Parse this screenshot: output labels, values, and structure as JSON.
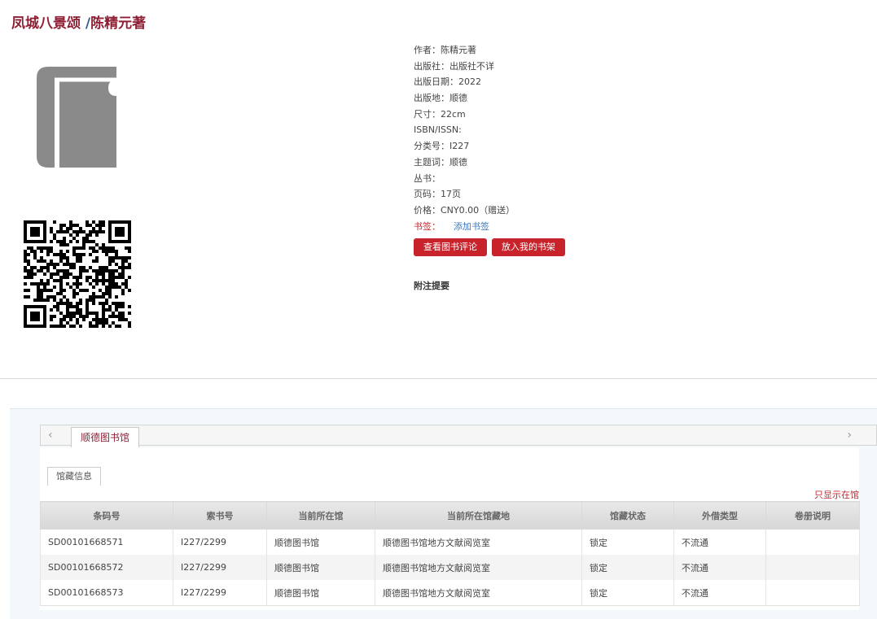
{
  "title": {
    "book": "凤城八景颂",
    "separator": " /",
    "author": "陈精元著"
  },
  "metadata": [
    {
      "label": "作者：",
      "value": "陈精元著"
    },
    {
      "label": "出版社：",
      "value": "出版社不详"
    },
    {
      "label": "出版日期：",
      "value": "2022"
    },
    {
      "label": "出版地：",
      "value": "顺德"
    },
    {
      "label": "尺寸：",
      "value": "22cm"
    },
    {
      "label": "ISBN/ISSN:",
      "value": ""
    },
    {
      "label": "分类号：",
      "value": "I227"
    },
    {
      "label": "主题词：",
      "value": "顺德"
    },
    {
      "label": "丛书：",
      "value": ""
    },
    {
      "label": "页码：",
      "value": "17页"
    },
    {
      "label": "价格：",
      "value": "CNY0.00（赠送）"
    }
  ],
  "bookmark": {
    "label": "书签：",
    "link": "添加书签"
  },
  "actions": {
    "view_reviews": "查看图书评论",
    "add_to_shelf": "放入我的书架"
  },
  "notes_heading": "附注提要",
  "library_tab": "顺德图书馆",
  "info_tab": "馆藏信息",
  "filter_link": "只显示在馆",
  "icons": {
    "prev": "chevron-left-icon",
    "next": "chevron-right-icon",
    "book": "book-icon",
    "qr": "qr-code"
  },
  "table": {
    "headers": [
      "条码号",
      "索书号",
      "当前所在馆",
      "当前所在馆藏地",
      "馆藏状态",
      "外借类型",
      "卷册说明"
    ],
    "rows": [
      [
        "SD00101668571",
        "I227/2299",
        "顺德图书馆",
        "顺德图书馆地方文献阅览室",
        "锁定",
        "不流通",
        ""
      ],
      [
        "SD00101668572",
        "I227/2299",
        "顺德图书馆",
        "顺德图书馆地方文献阅览室",
        "锁定",
        "不流通",
        ""
      ],
      [
        "SD00101668573",
        "I227/2299",
        "顺德图书馆",
        "顺德图书馆地方文献阅览室",
        "锁定",
        "不流通",
        ""
      ]
    ]
  },
  "colors": {
    "title": "#8f1f34",
    "button": "#c8222b",
    "link": "#3a78c2",
    "label_red": "#c2272d"
  }
}
